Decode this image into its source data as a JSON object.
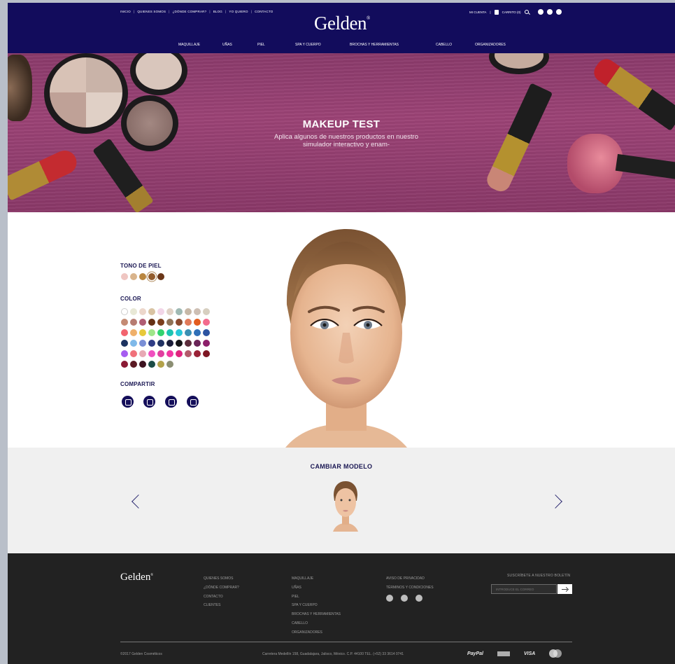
{
  "header": {
    "top_links": [
      "INICIO",
      "QUIENES SOMOS",
      "¿DÓNDE COMPRAR?",
      "BLOG",
      "YO QUIERO",
      "CONTACTO"
    ],
    "logo_text": "Gelden",
    "logo_mark": "®",
    "account_label": "MI CUENTA",
    "cart_label": "CARRITO (0)",
    "nav": [
      "MAQUILLAJE",
      "UÑAS",
      "PIEL",
      "SPA Y CUERPO",
      "BROCHAS Y HERRAMIENTAS",
      "CABELLO",
      "ORGANIZADORES"
    ],
    "colors": {
      "bar": "#120c5c"
    }
  },
  "hero": {
    "title": "MAKEUP TEST",
    "subtitle": "Aplica algunos de nuestros productos en nuestro simulador interactivo y enam-"
  },
  "simulator": {
    "skin_tone_label": "TONO DE PIEL",
    "skin_tones": [
      "#efc6c2",
      "#d9b48c",
      "#b98640",
      "#935c2d",
      "#6a3618"
    ],
    "color_label": "COLOR",
    "colors": [
      "#ffffff",
      "#e8e8d6",
      "#ecd7cb",
      "#d9c3a3",
      "#f2d6e8",
      "#e0d2c6",
      "#9fb9b3",
      "#c7b8a7",
      "#cdbfb4",
      "#d7cfc0",
      "#c48b74",
      "#b77c72",
      "#b05d73",
      "#653015",
      "#7b3f1d",
      "#8f7357",
      "#8a4a2f",
      "#e07a5a",
      "#e35c1f",
      "#f36b8d",
      "#f2646f",
      "#efb06b",
      "#e8c93a",
      "#9fe68a",
      "#33d36f",
      "#1cc4b2",
      "#28c7d8",
      "#3a8fb3",
      "#2f6fb7",
      "#2c53a1",
      "#1c3360",
      "#7fb9e9",
      "#7a8fd6",
      "#2f3d86",
      "#203262",
      "#1b1e3a",
      "#141517",
      "#5b2c3b",
      "#6a2457",
      "#8c1f6a",
      "#a65cf0",
      "#f0707a",
      "#e7a9b4",
      "#f050c0",
      "#e13fa0",
      "#f236a3",
      "#e0247e",
      "#b35a6a",
      "#9a2236",
      "#7e1623",
      "#8b1a34",
      "#5b1a23",
      "#3c1320",
      "#1b4c46",
      "#b3a24a",
      "#8b8e73"
    ],
    "share_label": "COMPARTIR",
    "share_icons": [
      "instagram-icon",
      "twitter-icon",
      "facebook-icon",
      "email-icon"
    ]
  },
  "model_selector": {
    "title": "CAMBIAR MODELO"
  },
  "footer": {
    "logo_text": "Gelden",
    "logo_mark": "®",
    "col1": [
      "QUIENES SOMOS",
      "¿DÓNDE COMPRAR?",
      "CONTACTO",
      "CLIENTES"
    ],
    "col2": [
      "MAQUILLAJE",
      "UÑAS",
      "PIEL",
      "SPA Y CUERPO",
      "BROCHAS Y HERRAMIENTAS",
      "CABELLO",
      "ORGANIZADORES"
    ],
    "col3": [
      "AVISO DE PRIVACIDAD",
      "TÉRMINOS Y CONDICIONES"
    ],
    "newsletter_label": "SUSCRÍBETE A NUESTRO BOLETÍN",
    "newsletter_placeholder": "INTRODUCE EL CORREO",
    "copyright": "©2017 Gelden Cosméticos",
    "address": "Carretera Medellín 158, Guadalajara, Jalisco, México. C.P. 44100 TEL. (+52) 33 3614 0741",
    "payments": [
      "PayPal",
      "VISA"
    ]
  }
}
